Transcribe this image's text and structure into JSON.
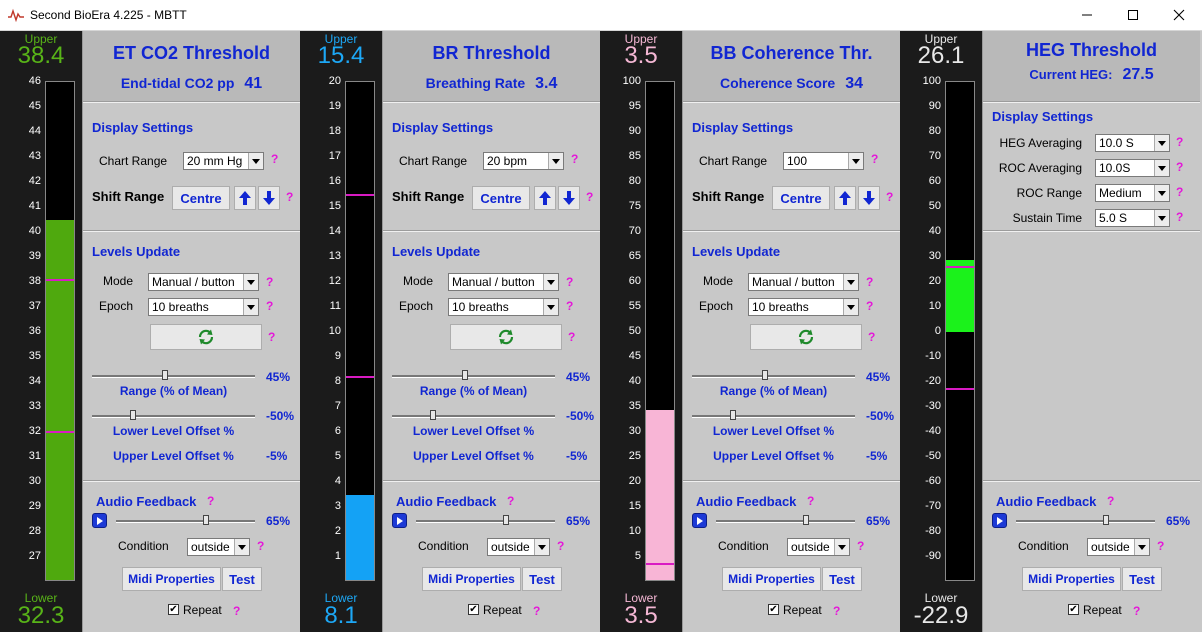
{
  "window": {
    "title": "Second BioEra 4.225 - MBTT"
  },
  "common": {
    "upper_label": "Upper",
    "lower_label": "Lower",
    "display_settings": "Display Settings",
    "chart_range_label": "Chart Range",
    "shift_range_label": "Shift Range",
    "centre_label": "Centre",
    "levels_update": "Levels Update",
    "mode_label": "Mode",
    "mode_value": "Manual / button",
    "epoch_label": "Epoch",
    "epoch_value": "10 breaths",
    "range_value": "45%",
    "range_caption": "Range (% of Mean)",
    "lower_offset_value": "-50%",
    "lower_offset_caption": "Lower Level Offset %",
    "upper_offset_caption": "Upper Level Offset %",
    "upper_offset_value": "-5%",
    "audio_feedback": "Audio Feedback",
    "volume_value": "65%",
    "condition_label": "Condition",
    "condition_value": "outside",
    "midi_label": "Midi Properties",
    "test_label": "Test",
    "repeat_label": "Repeat",
    "help": "?",
    "check": "✔",
    "volume_fraction": 0.65,
    "range_fraction": 0.45,
    "lower_offset_fraction": 0.25
  },
  "heg": {
    "averaging_label": "HEG Averaging",
    "averaging_value": "10.0 S",
    "roc_averaging_label": "ROC Averaging",
    "roc_averaging_value": "10.0S",
    "roc_range_label": "ROC Range",
    "roc_range_value": "Medium",
    "sustain_label": "Sustain Time",
    "sustain_value": "5.0 S"
  },
  "modules": [
    {
      "title": "ET CO2 Threshold",
      "subtitle": "End-tidal CO2 pp",
      "value": "41",
      "upper": "38.4",
      "lower": "32.3",
      "color": "#4fa90e",
      "value_color": "#58b418",
      "chart_range": "20 mm Hg",
      "scale": {
        "min": 26,
        "max": 46,
        "step": 1
      },
      "fill": [
        26,
        40.5
      ],
      "markers": [
        38.1,
        32.0
      ]
    },
    {
      "title": "BR Threshold",
      "subtitle": "Breathing Rate",
      "value": "3.4",
      "upper": "15.4",
      "lower": "8.1",
      "color": "#14a2f5",
      "value_color": "#1da8f6",
      "chart_range": "20 bpm",
      "scale": {
        "min": 0,
        "max": 20,
        "step": 1
      },
      "fill": [
        0,
        3.5
      ],
      "markers": [
        15.5,
        8.2
      ]
    },
    {
      "title": "BB Coherence Thr.",
      "subtitle": "Coherence Score",
      "value": "34",
      "upper": "3.5",
      "lower": "3.5",
      "color": "#f8b5d6",
      "value_color": "#f4b7d4",
      "chart_range": "100",
      "scale": {
        "min": 0,
        "max": 100,
        "step": 5
      },
      "fill": [
        0,
        34.5
      ],
      "markers": [
        3.6
      ]
    },
    {
      "title": "HEG Threshold",
      "subtitle": "Current HEG:",
      "value": "27.5",
      "upper": "26.1",
      "lower": "-22.9",
      "color": "#1bf21b",
      "value_color": "#e8e8e8",
      "scale": {
        "min": -100,
        "max": 100,
        "step": 10
      },
      "fill": [
        0,
        29
      ],
      "markers": [
        26.1,
        -22.9
      ]
    }
  ]
}
